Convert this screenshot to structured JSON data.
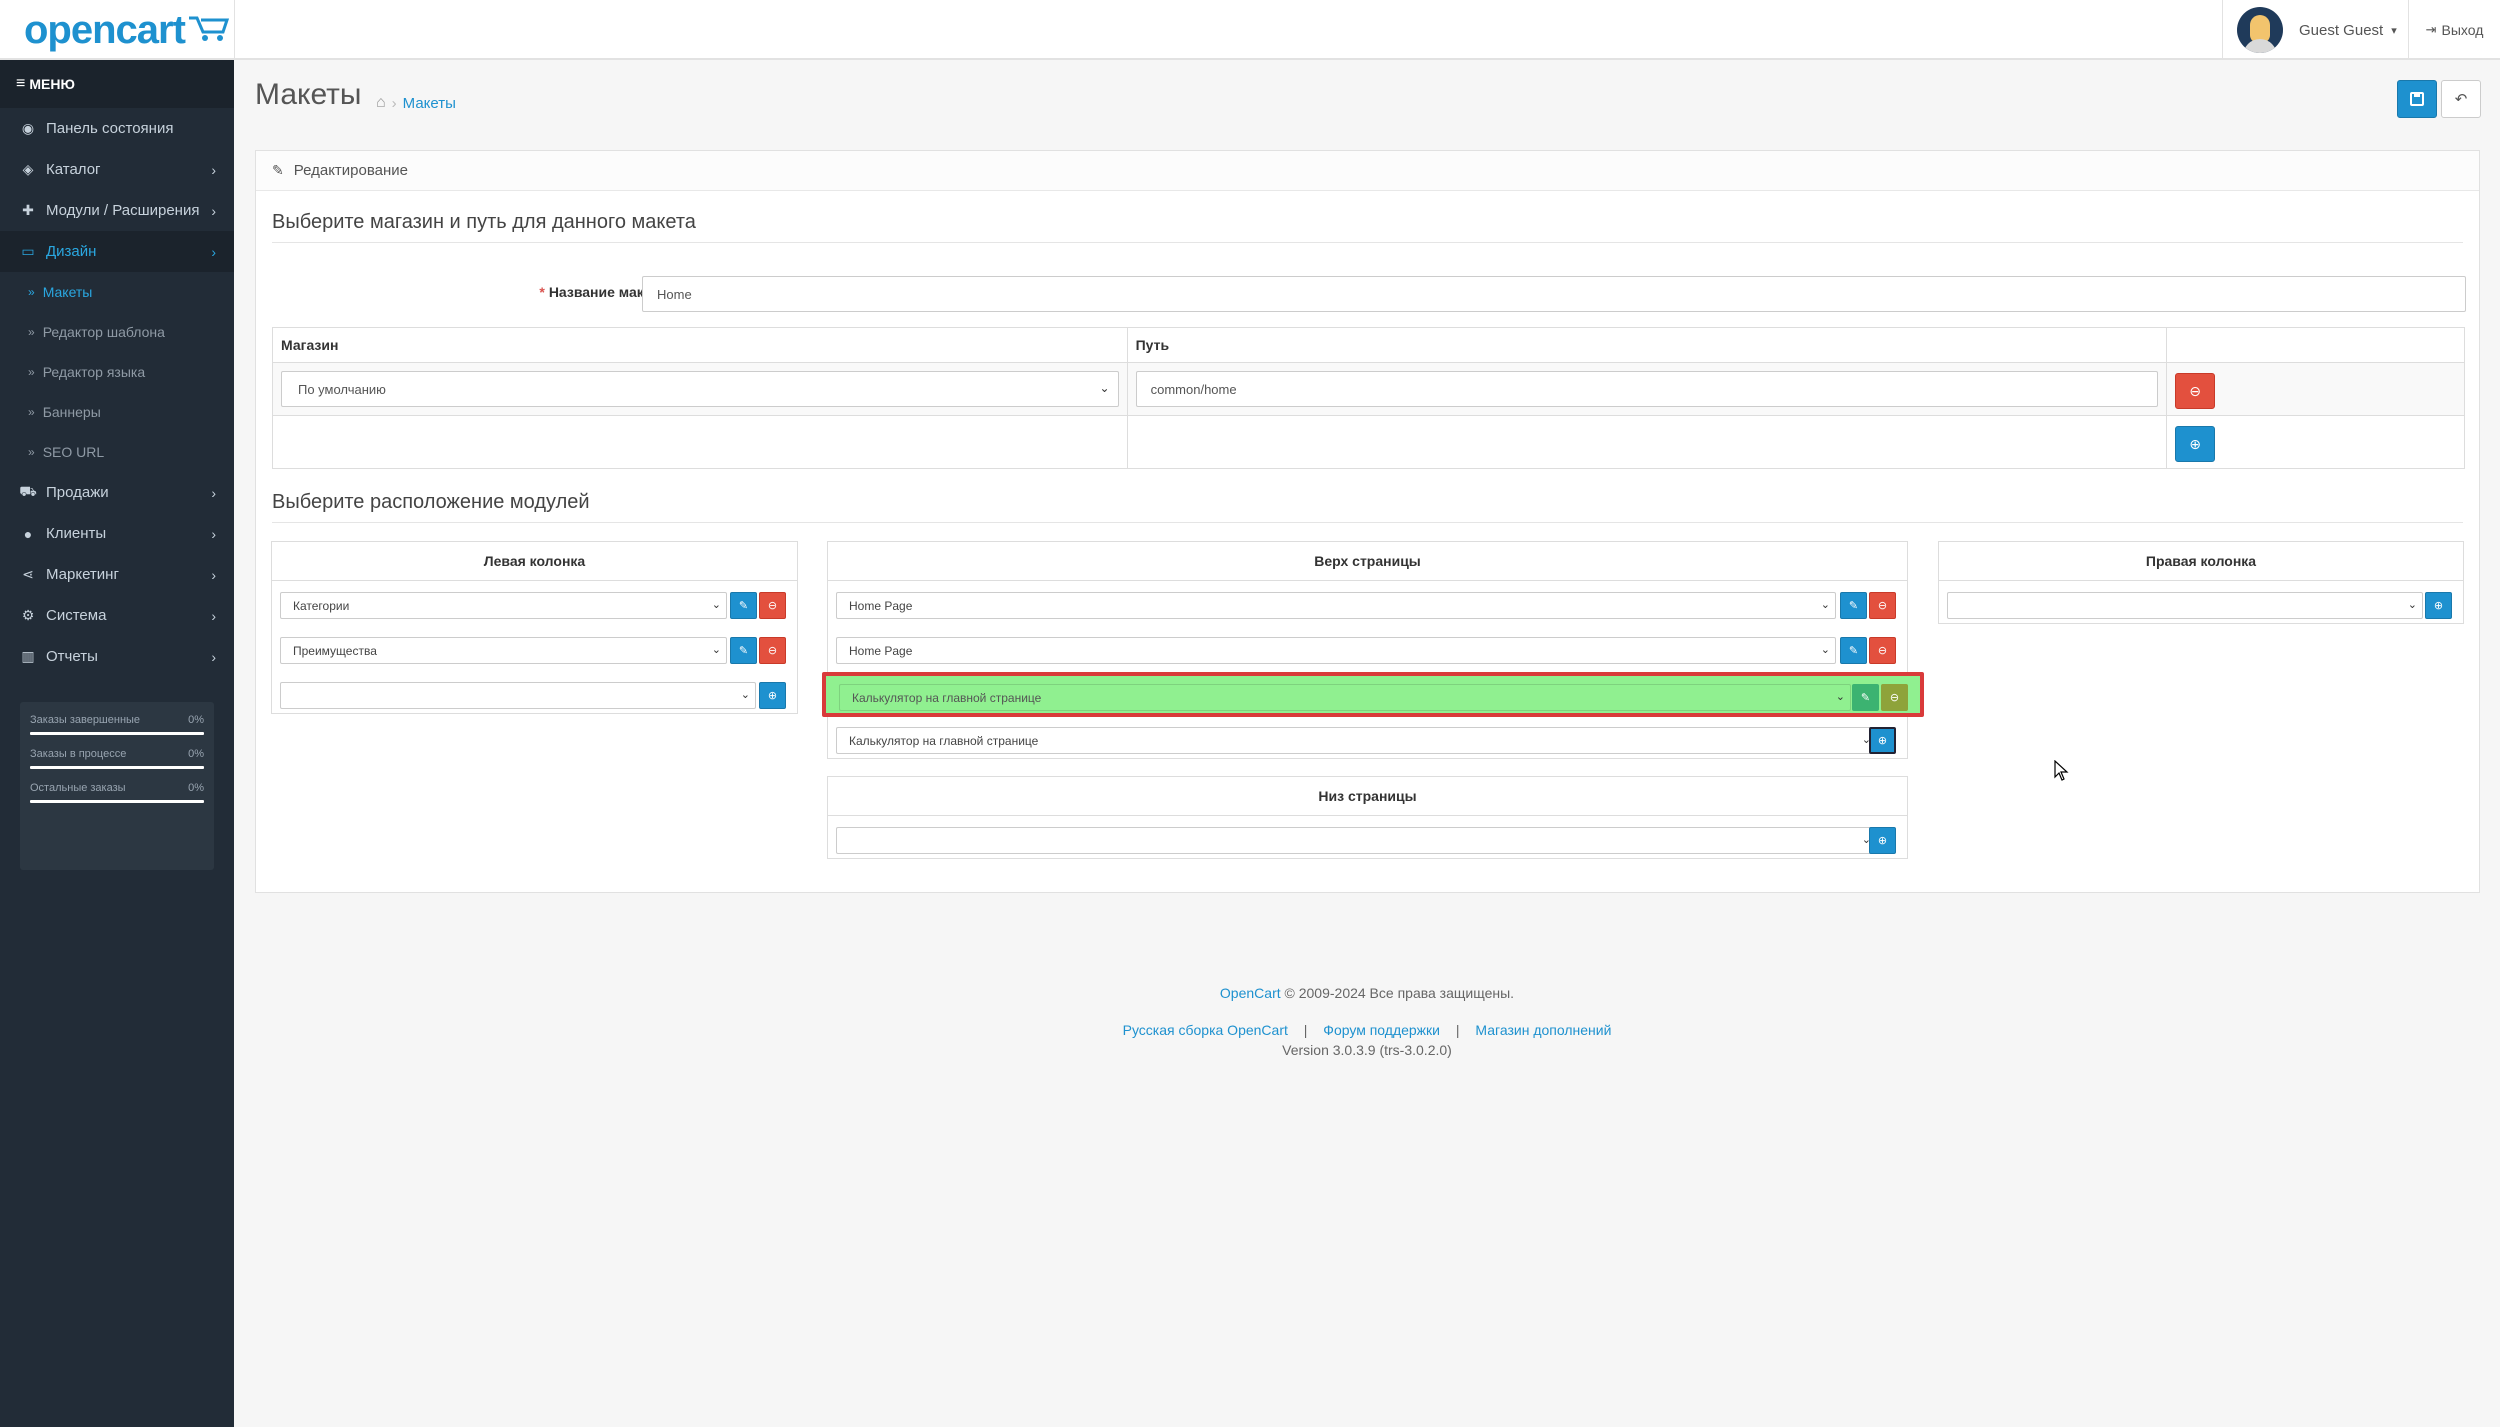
{
  "header": {
    "logo_text": "opencart",
    "user_name": "Guest Guest",
    "logout": "Выход"
  },
  "sidebar": {
    "menu_label": "МЕНЮ",
    "items": [
      {
        "label": "Панель состояния",
        "icon": "dashboard-icon"
      },
      {
        "label": "Каталог",
        "icon": "tags-icon"
      },
      {
        "label": "Модули / Расширения",
        "icon": "puzzle-icon"
      },
      {
        "label": "Дизайн",
        "icon": "monitor-icon"
      },
      {
        "label": "Продажи",
        "icon": "cart-icon"
      },
      {
        "label": "Клиенты",
        "icon": "user-icon"
      },
      {
        "label": "Маркетинг",
        "icon": "share-icon"
      },
      {
        "label": "Система",
        "icon": "cog-icon"
      },
      {
        "label": "Отчеты",
        "icon": "bar-chart-icon"
      }
    ],
    "design_sub": [
      "Макеты",
      "Редактор шаблона",
      "Редактор языка",
      "Баннеры",
      "SEO URL"
    ],
    "stats": [
      {
        "label": "Заказы завершенные",
        "value": "0%"
      },
      {
        "label": "Заказы в процессе",
        "value": "0%"
      },
      {
        "label": "Остальные заказы",
        "value": "0%"
      }
    ]
  },
  "page": {
    "title": "Макеты",
    "breadcrumb": "Макеты"
  },
  "panel": {
    "heading": "Редактирование",
    "legend_route": "Выберите магазин и путь для данного макета",
    "name_label": "Название макета",
    "name_value": "Home",
    "route_headers": [
      "Магазин",
      "Путь",
      ""
    ],
    "store_value": "По умолчанию",
    "route_value": "common/home",
    "legend_modules": "Выберите расположение модулей",
    "left_column": {
      "title": "Левая колонка",
      "modules": [
        "Категории",
        "Преимущества"
      ],
      "new_value": ""
    },
    "top_column": {
      "title": "Верх страницы",
      "modules": [
        "Home Page",
        "Home Page",
        "Калькулятор на главной странице"
      ],
      "new_value": "Калькулятор на главной странице"
    },
    "bottom_column": {
      "title": "Низ страницы",
      "new_value": ""
    },
    "right_column": {
      "title": "Правая колонка",
      "new_value": ""
    }
  },
  "footer": {
    "brand": "OpenCart",
    "copyright": "© 2009-2024 Все права защищены.",
    "link1": "Русская сборка OpenCart",
    "link2": "Форум поддержки",
    "link3": "Магазин дополнений",
    "version": "Version 3.0.3.9 (trs-3.0.2.0)"
  },
  "colors": {
    "primary": "#1e91cf",
    "danger": "#e3503e",
    "sidebar": "#222c37",
    "highlight": "#90f090",
    "highlight_border": "#d93a3a"
  }
}
